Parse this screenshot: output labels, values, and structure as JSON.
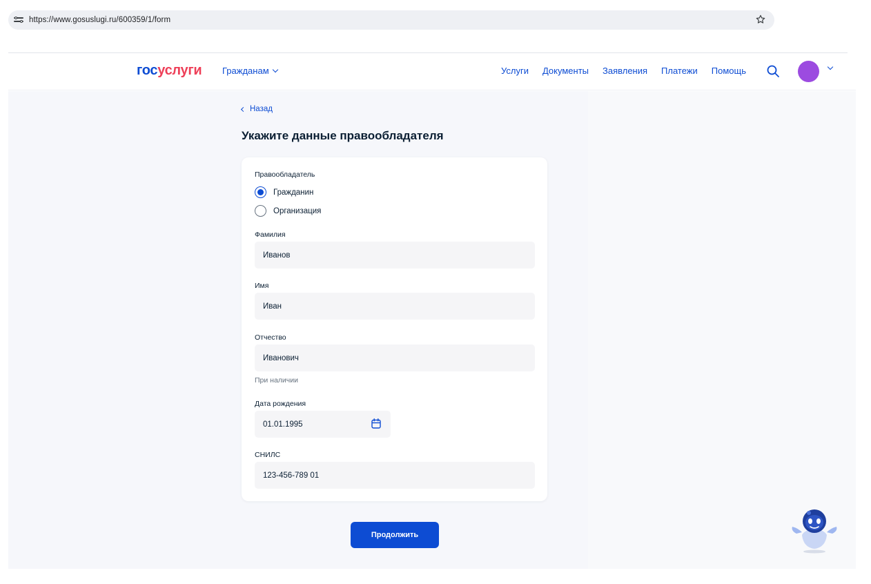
{
  "browser": {
    "url": "https://www.gosuslugi.ru/600359/1/form"
  },
  "header": {
    "logo_part1": "гос",
    "logo_part2": "услуги",
    "citizens_menu": "Гражданам",
    "nav": [
      "Услуги",
      "Документы",
      "Заявления",
      "Платежи",
      "Помощь"
    ],
    "avatar_color": "#9c4be0"
  },
  "page": {
    "back_label": "Назад",
    "title": "Укажите данные правообладателя"
  },
  "form": {
    "owner_label": "Правообладатель",
    "owner_options": [
      {
        "label": "Гражданин",
        "selected": true
      },
      {
        "label": "Организация",
        "selected": false
      }
    ],
    "surname_label": "Фамилия",
    "surname_value": "Иванов",
    "name_label": "Имя",
    "name_value": "Иван",
    "patronymic_label": "Отчество",
    "patronymic_value": "Иванович",
    "patronymic_hint": "При наличии",
    "birthdate_label": "Дата рождения",
    "birthdate_value": "01.01.1995",
    "snils_label": "СНИЛС",
    "snils_value": "123-456-789 01"
  },
  "actions": {
    "continue_label": "Продолжить"
  },
  "colors": {
    "primary": "#0d4cd3",
    "logo_accent": "#ee3f58"
  },
  "icons": [
    "site-settings-icon",
    "bookmark-star-icon",
    "search-icon",
    "chevron-down-icon",
    "chevron-left-icon",
    "calendar-icon",
    "robot-assistant-icon"
  ]
}
